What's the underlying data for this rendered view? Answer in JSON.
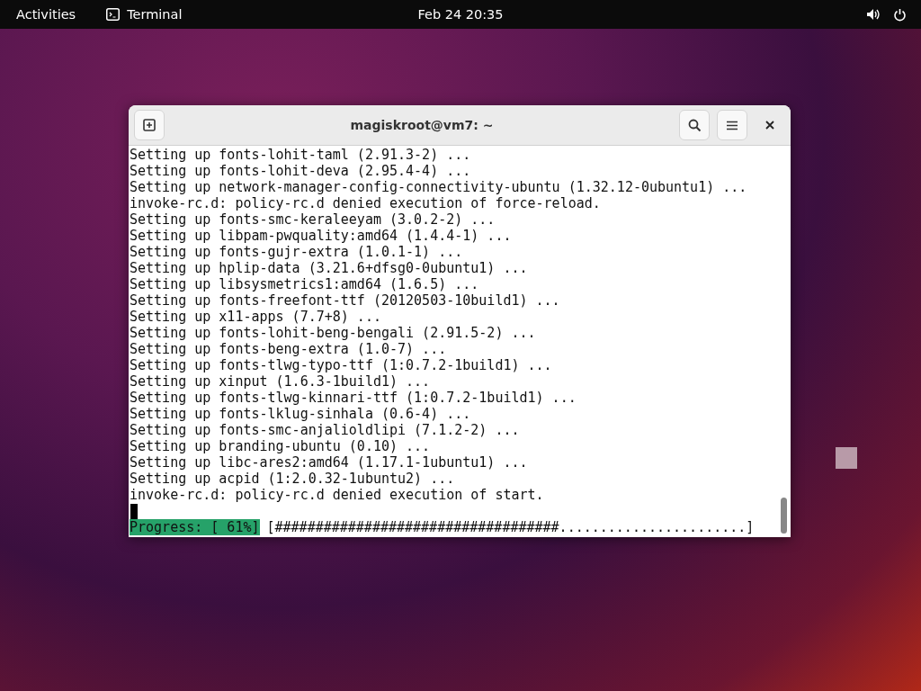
{
  "top_bar": {
    "activities": "Activities",
    "app": "Terminal",
    "clock": "Feb 24  20:35"
  },
  "window": {
    "title": "magiskroot@vm7: ~",
    "lines": [
      "Setting up fonts-lohit-taml (2.91.3-2) ...",
      "Setting up fonts-lohit-deva (2.95.4-4) ...",
      "Setting up network-manager-config-connectivity-ubuntu (1.32.12-0ubuntu1) ...",
      "invoke-rc.d: policy-rc.d denied execution of force-reload.",
      "Setting up fonts-smc-keraleeyam (3.0.2-2) ...",
      "Setting up libpam-pwquality:amd64 (1.4.4-1) ...",
      "Setting up fonts-gujr-extra (1.0.1-1) ...",
      "Setting up hplip-data (3.21.6+dfsg0-0ubuntu1) ...",
      "Setting up libsysmetrics1:amd64 (1.6.5) ...",
      "Setting up fonts-freefont-ttf (20120503-10build1) ...",
      "Setting up x11-apps (7.7+8) ...",
      "Setting up fonts-lohit-beng-bengali (2.91.5-2) ...",
      "Setting up fonts-beng-extra (1.0-7) ...",
      "Setting up fonts-tlwg-typo-ttf (1:0.7.2-1build1) ...",
      "Setting up xinput (1.6.3-1build1) ...",
      "Setting up fonts-tlwg-kinnari-ttf (1:0.7.2-1build1) ...",
      "Setting up fonts-lklug-sinhala (0.6-4) ...",
      "Setting up fonts-smc-anjalioldlipi (7.1.2-2) ...",
      "Setting up branding-ubuntu (0.10) ...",
      "Setting up libc-ares2:amd64 (1.17.1-1ubuntu1) ...",
      "Setting up acpid (1:2.0.32-1ubuntu2) ...",
      "invoke-rc.d: policy-rc.d denied execution of start."
    ],
    "progress_label": "Progress: [ 61%]",
    "progress_bar": "[###################################.......................]"
  }
}
